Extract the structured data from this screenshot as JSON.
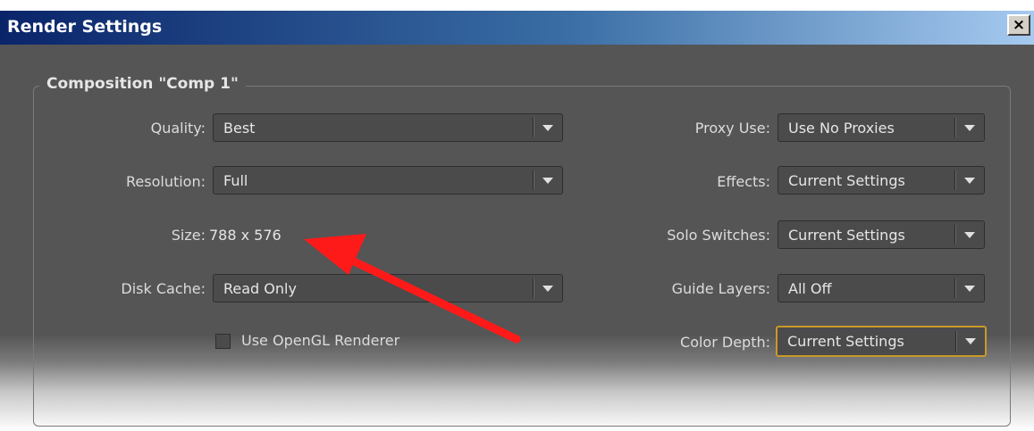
{
  "window": {
    "title": "Render Settings",
    "close_label": "×"
  },
  "group": {
    "title": "Composition \"Comp 1\""
  },
  "left": {
    "quality": {
      "label": "Quality:",
      "value": "Best"
    },
    "resolution": {
      "label": "Resolution:",
      "value": "Full"
    },
    "size": {
      "label": "Size:",
      "value": "788 x 576"
    },
    "disk_cache": {
      "label": "Disk Cache:",
      "value": "Read Only"
    },
    "opengl": {
      "label": "Use OpenGL Renderer",
      "checked": false
    }
  },
  "right": {
    "proxy_use": {
      "label": "Proxy Use:",
      "value": "Use No Proxies"
    },
    "effects": {
      "label": "Effects:",
      "value": "Current Settings"
    },
    "solo_switches": {
      "label": "Solo Switches:",
      "value": "Current Settings"
    },
    "guide_layers": {
      "label": "Guide Layers:",
      "value": "All Off"
    },
    "color_depth": {
      "label": "Color Depth:",
      "value": "Current Settings"
    }
  },
  "annotation": {
    "arrow_color": "#ff1a1a"
  },
  "colors": {
    "panel_bg": "#555555",
    "focus_border": "#c89a2a",
    "title_bar_start": "#0a246a"
  }
}
